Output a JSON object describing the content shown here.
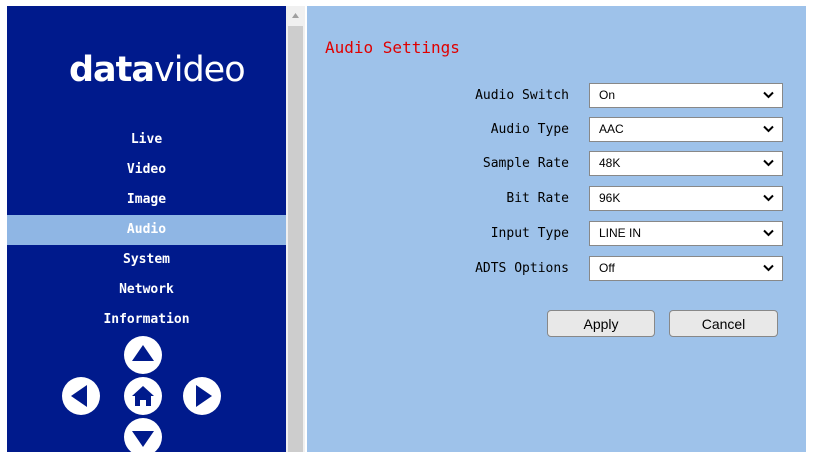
{
  "logo": {
    "bold": "data",
    "light": "video"
  },
  "nav": {
    "items": [
      {
        "label": "Live"
      },
      {
        "label": "Video"
      },
      {
        "label": "Image"
      },
      {
        "label": "Audio"
      },
      {
        "label": "System"
      },
      {
        "label": "Network"
      },
      {
        "label": "Information"
      }
    ],
    "active": "Audio"
  },
  "ptz": {
    "up_icon": "chevron-up-icon",
    "left_icon": "chevron-left-icon",
    "home_icon": "home-icon",
    "right_icon": "chevron-right-icon",
    "down_icon": "chevron-down-icon"
  },
  "main": {
    "title": "Audio Settings",
    "fields": [
      {
        "label": "Audio Switch",
        "value": "On"
      },
      {
        "label": "Audio Type",
        "value": "AAC"
      },
      {
        "label": "Sample Rate",
        "value": "48K"
      },
      {
        "label": "Bit Rate",
        "value": "96K"
      },
      {
        "label": "Input Type",
        "value": "LINE IN"
      },
      {
        "label": "ADTS Options",
        "value": "Off"
      }
    ],
    "apply_label": "Apply",
    "cancel_label": "Cancel"
  },
  "colors": {
    "sidebar_bg": "#001a8c",
    "active_item_bg": "#8fb6e4",
    "main_bg": "#9ec2ea",
    "title_color": "#e00000"
  }
}
